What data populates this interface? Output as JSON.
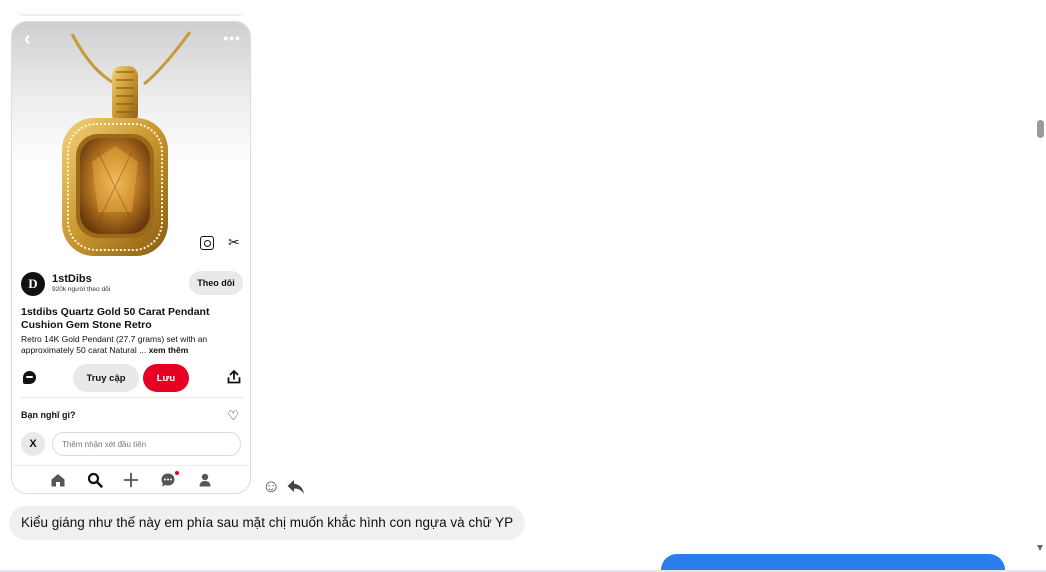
{
  "pin": {
    "author": {
      "name": "1stDibs",
      "avatar_letter": "D",
      "followers": "920k người theo dõi",
      "follow_label": "Theo dõi"
    },
    "title": "1stdibs Quartz Gold 50 Carat Pendant Cushion Gem Stone Retro",
    "description": "Retro 14K Gold Pendant (27.7 grams) set with an approximately 50 carat Natural ...",
    "see_more": "xem thêm",
    "visit_label": "Truy cập",
    "save_label": "Lưu",
    "comment_prompt": "Bạn nghĩ gì?",
    "user_initial": "X",
    "comment_placeholder": "Thêm nhận xét đầu tiên",
    "back_glyph": "‹",
    "more_glyph": "•••",
    "scissors_glyph": "✂",
    "heart_glyph": "♡"
  },
  "chat": {
    "message_text": "Kiểu giáng như thế này em phía sau mặt chị muốn khắc hình con ngựa và chữ YP",
    "emoji_glyph": "☺"
  },
  "colors": {
    "save_red": "#e60023",
    "outgoing_blue": "#2b7de9",
    "bubble_gray": "#f0f0f0"
  }
}
